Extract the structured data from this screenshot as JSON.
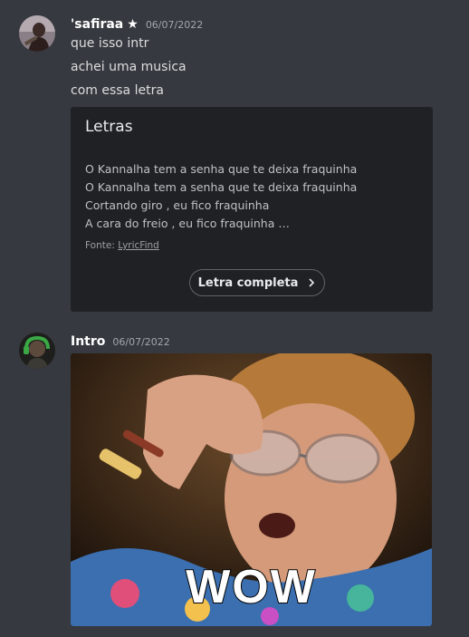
{
  "messages": [
    {
      "username": "'safiraa",
      "badge": "★",
      "timestamp": "06/07/2022",
      "lines": [
        "que isso intr",
        "achei uma musica",
        "com essa letra"
      ],
      "embed": {
        "title": "Letras",
        "lyrics": [
          "O Kannalha tem a senha que te deixa fraquinha",
          "O Kannalha tem a senha que te deixa fraquinha",
          "Cortando giro , eu fico fraquinha",
          "A cara do freio , eu fico fraquinha …"
        ],
        "source_label": "Fonte:",
        "source_link": "LyricFind",
        "button_label": "Letra completa"
      }
    },
    {
      "username": "Intro",
      "timestamp": "06/07/2022",
      "gif_caption": "WOW"
    }
  ],
  "colors": {
    "background": "#36393f",
    "embed_background": "#202124",
    "username": "#ffffff",
    "message_text": "#dcddde",
    "timestamp": "#a3a6aa"
  },
  "icons": [
    "avatar-safiraa",
    "avatar-intro",
    "chevron-right-icon",
    "star-badge-icon"
  ]
}
